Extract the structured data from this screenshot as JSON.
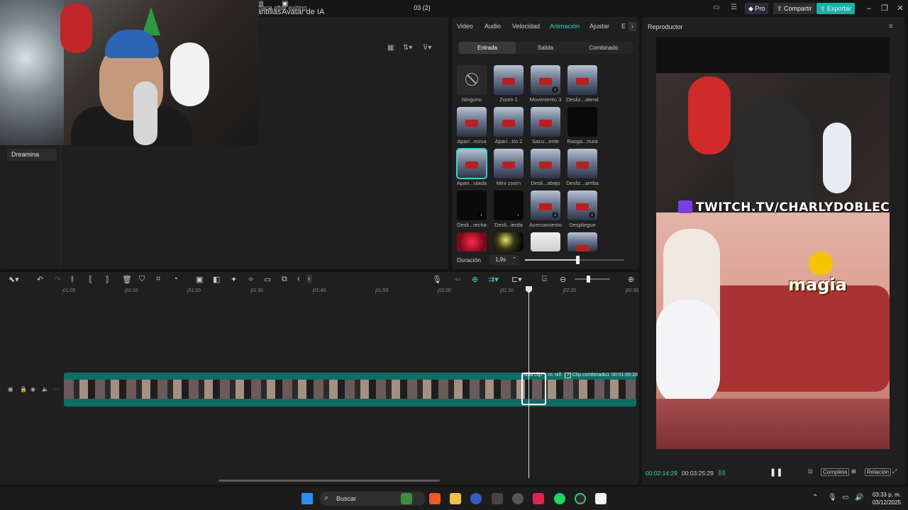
{
  "topbar": {
    "hint": "pace after exiting",
    "project": "03 (2)",
    "pro_label": "Pro",
    "share_label": "Compartir",
    "export_label": "Exportar",
    "colors": {
      "export": "#16b3a7",
      "pro": "#2d2d3d"
    }
  },
  "leftpanel": {
    "tabs": [
      {
        "label": "antillas"
      },
      {
        "label": "Avatar de IA"
      }
    ],
    "sidebar_items": [
      {
        "label": "Dreamina"
      }
    ]
  },
  "animation_panel": {
    "tabs": [
      "Video",
      "Audio",
      "Velocidad",
      "Animación",
      "Ajustar",
      "E"
    ],
    "active_tab": "Animación",
    "subtabs": [
      "Entrada",
      "Salida",
      "Combinado"
    ],
    "active_subtab": "Entrada",
    "effects": [
      {
        "label": "Ninguno",
        "style": "none",
        "icon": "ban-icon"
      },
      {
        "label": "Zoom 1",
        "style": "photo"
      },
      {
        "label": "Movimiento 3",
        "style": "photo",
        "download": true
      },
      {
        "label": "Desliz...ateral",
        "style": "photo"
      },
      {
        "label": "Apari...esiva",
        "style": "photo"
      },
      {
        "label": "Apari...tro 2",
        "style": "photo"
      },
      {
        "label": "Sacu...ente",
        "style": "photo"
      },
      {
        "label": "Rasga...rtura",
        "style": "dark"
      },
      {
        "label": "Apari...ulada",
        "style": "photo",
        "selected": true
      },
      {
        "label": "Mini zoom",
        "style": "photo"
      },
      {
        "label": "Desli...abajo",
        "style": "photo"
      },
      {
        "label": "Desliz...arriba",
        "style": "photo"
      },
      {
        "label": "Desli...recha",
        "style": "dark",
        "download": true
      },
      {
        "label": "Desli...ierda",
        "style": "dark",
        "download": true
      },
      {
        "label": "Acercamiento",
        "style": "photo",
        "download": true
      },
      {
        "label": "Despliegue",
        "style": "photo",
        "download": true
      },
      {
        "label": "",
        "style": "red"
      },
      {
        "label": "",
        "style": "lights"
      },
      {
        "label": "",
        "style": "white"
      },
      {
        "label": "",
        "style": "photo"
      }
    ],
    "duration_label": "Duración",
    "duration_value": "1,9s",
    "duration_fraction": 0.53
  },
  "player": {
    "title": "Reproductor",
    "overlay_text": "TWITCH.TV/CHARLYDOBLEC",
    "caption": "magia",
    "current_time": "00:02:14:29",
    "total_time": "00:03:25:29",
    "full_label": "Completa",
    "ratio_label": "Relación"
  },
  "timeline": {
    "ruler": [
      "01:00",
      "01:10",
      "01:20",
      "01:30",
      "01:40",
      "01:50",
      "02:00",
      "02:10",
      "02:20",
      "02:30"
    ],
    "clip_labels": [
      "niña clip",
      "m",
      "niñ",
      "Clip combinado1",
      "00:01:05:28"
    ]
  },
  "taskbar": {
    "search_placeholder": "Buscar",
    "time": "03:33 p. m.",
    "date": "03/12/2025"
  }
}
